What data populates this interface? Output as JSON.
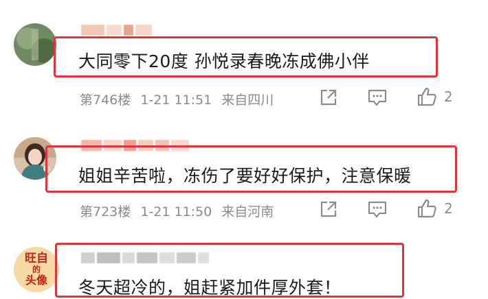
{
  "comments": [
    {
      "text": "大同零下20度 孙悦录春晚冻成佛小伴",
      "floor": "第746楼",
      "time": "1-21 11:51",
      "location": "来自四川",
      "likes": "2"
    },
    {
      "text": "姐姐辛苦啦，冻伤了要好好保护，注意保暖",
      "floor": "第723楼",
      "time": "1-21 11:50",
      "location": "来自河南",
      "likes": "2"
    },
    {
      "text": "冬天超冷的，姐赶紧加件厚外套！",
      "avatar_text": [
        "旺自",
        "的",
        "头像"
      ]
    }
  ],
  "icons": [
    "share-icon",
    "comment-icon",
    "like-icon"
  ],
  "colors": {
    "highlight_border": "#d9363e",
    "meta_text": "#8a8a8a",
    "body_text": "#1a1a1a"
  }
}
